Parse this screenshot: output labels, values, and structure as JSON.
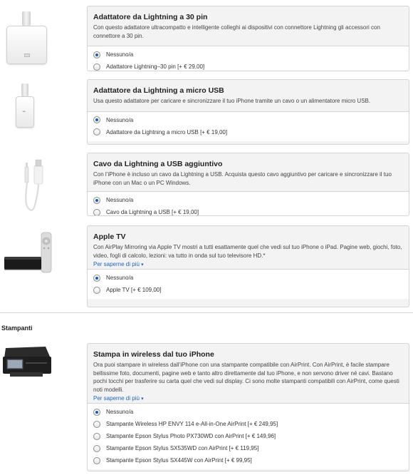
{
  "accessories": [
    {
      "title": "Adattatore da Lightning a 30 pin",
      "description": "Con questo adattatore ultracompatto e intelligente colleghi ai dispositivi con connettore Lightning gli accessori con connettore a 30 pin.",
      "options": [
        {
          "label": "Nessuno/a",
          "selected": true
        },
        {
          "label": "Adattatore Lightning–30 pin [+ € 29,00]",
          "selected": false
        }
      ]
    },
    {
      "title": "Adattatore da Lightning a micro USB",
      "description": "Usa questo adattatore per caricare e sincronizzare il tuo iPhone tramite un cavo o un alimentatore micro USB.",
      "options": [
        {
          "label": "Nessuno/a",
          "selected": true
        },
        {
          "label": "Adattatore da Lightning a micro USB [+ € 19,00]",
          "selected": false
        }
      ]
    },
    {
      "title": "Cavo da Lightning a USB aggiuntivo",
      "description": "Con l’iPhone è incluso un cavo da Lightning a USB. Acquista questo cavo aggiuntivo per caricare e sincronizzare il tuo iPhone con un Mac o un PC Windows.",
      "options": [
        {
          "label": "Nessuno/a",
          "selected": true
        },
        {
          "label": "Cavo da Lightning a USB [+ € 19,00]",
          "selected": false
        }
      ]
    },
    {
      "title": "Apple TV",
      "description": "Con AirPlay Mirroring via Apple TV mostri a tutti esattamente quel che vedi sul tuo iPhone o iPad. Pagine web, giochi, foto, video, fogli di calcolo, lezioni: va tutto in onda sul tuo televisore HD.*",
      "more_link": "Per saperne di più",
      "options": [
        {
          "label": "Nessuno/a",
          "selected": true
        },
        {
          "label": "Apple TV [+ € 109,00]",
          "selected": false
        }
      ]
    }
  ],
  "printers_section": {
    "heading": "Stampanti",
    "title": "Stampa in wireless dal tuo iPhone",
    "description": "Ora puoi stampare in wireless dall’iPhone con una stampante compatibile con AirPrint. Con AirPrint, è facile stampare bellissime foto, documenti, pagine web e tanto altro direttamente dal tuo iPhone, e non servono driver né cavi. Bastano pochi tocchi per trasferire su carta quel che vedi sul display. Ci sono molte stampanti compatibili con AirPrint, come questi noti modelli.",
    "more_link": "Per saperne di più",
    "options": [
      {
        "label": "Nessuno/a",
        "selected": true
      },
      {
        "label": "Stampante Wireless HP ENVY 114 e-All-in-One AirPrint [+ € 249,95]",
        "selected": false
      },
      {
        "label": "Stampante Epson Stylus Photo PX730WD con AirPrint [+ € 149,96]",
        "selected": false
      },
      {
        "label": "Stampante Epson Stylus SX535WD con AirPrint [+ € 119,95]",
        "selected": false
      },
      {
        "label": "Stampante Epson Stylus SX445W con AirPrint [+ € 99,95]",
        "selected": false
      }
    ]
  },
  "icons": {
    "adapter_30pin": "lightning-30pin-adapter-icon",
    "adapter_microusb": "lightning-microusb-adapter-icon",
    "cable": "lightning-usb-cable-icon",
    "appletv": "apple-tv-icon",
    "printer": "printer-icon",
    "caret": "▾"
  },
  "colors": {
    "link": "#1a66c4",
    "panel_bg": "#f3f3f3",
    "radio_selected": "#1c5bb5"
  }
}
